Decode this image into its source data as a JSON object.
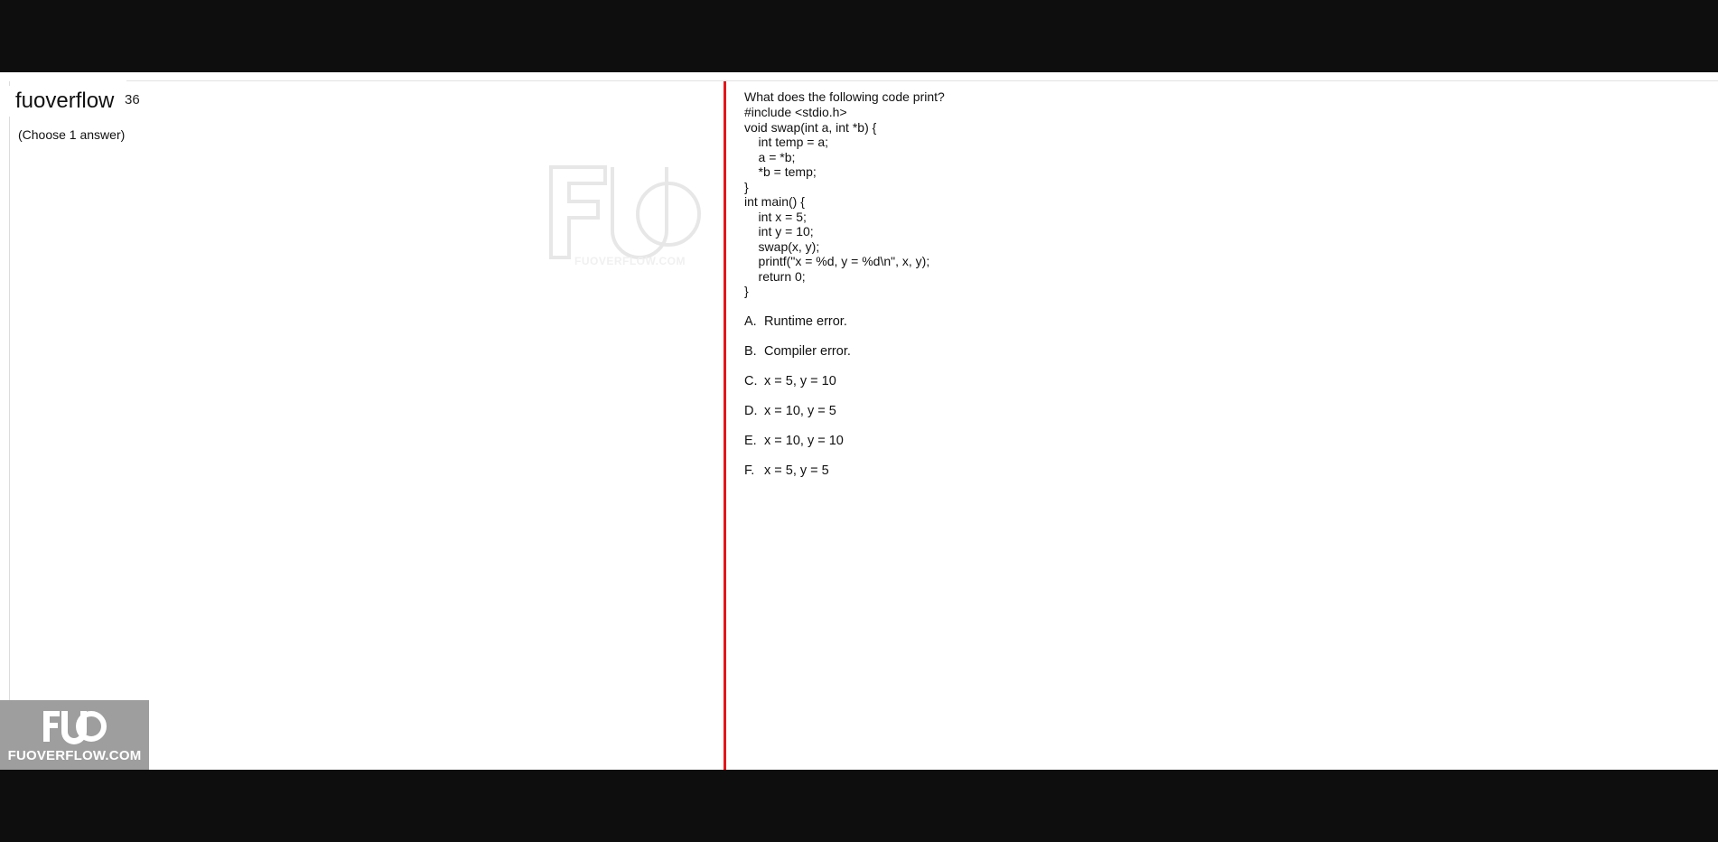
{
  "header": {
    "brand": "fuoverflow",
    "question_number_fragment": "36"
  },
  "left": {
    "instruction": "(Choose 1 answer)",
    "watermark_text": "FUOVERFLOW.COM",
    "logo_badge_text": "FUOVERFLOW.COM"
  },
  "question": {
    "prompt": "What does the following code print?",
    "code": [
      "#include <stdio.h>",
      "void swap(int a, int *b) {",
      "    int temp = a;",
      "    a = *b;",
      "    *b = temp;",
      "}",
      "int main() {",
      "    int x = 5;",
      "    int y = 10;",
      "    swap(x, y);",
      "    printf(\"x = %d, y = %d\\n\", x, y);",
      "    return 0;",
      "}"
    ],
    "options": [
      {
        "letter": "A.",
        "text": "Runtime error."
      },
      {
        "letter": "B.",
        "text": "Compiler error."
      },
      {
        "letter": "C.",
        "text": "x = 5, y = 10"
      },
      {
        "letter": "D.",
        "text": "x = 10, y = 5"
      },
      {
        "letter": "E.",
        "text": "x = 10, y = 10"
      },
      {
        "letter": "F.",
        "text": "x = 5, y = 5"
      }
    ]
  },
  "colors": {
    "divider": "#e3161c",
    "letterbox": "#0e0e0e",
    "badge": "#9e9e9e"
  },
  "icons": [
    "fuo-logo-icon"
  ]
}
